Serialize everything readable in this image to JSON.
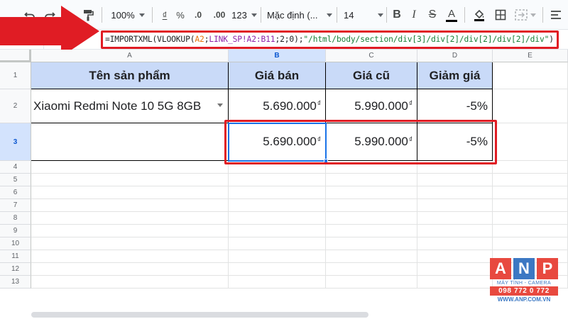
{
  "toolbar": {
    "zoom": "100%",
    "currency_symbol": "₫",
    "percent_symbol": "%",
    "decrease_decimal": ".0",
    "increase_decimal": ".00",
    "more_formats": "123",
    "font_family": "Mặc định (...",
    "font_size": "14",
    "bold": "B",
    "italic": "I",
    "strikethrough": "S",
    "text_color": "A"
  },
  "formula_bar": {
    "name_box": "B3",
    "formula_prefix": "=IMPORTXML(VLOOKUP(",
    "formula_ref1": "A2",
    "formula_sep1": ";",
    "formula_ref2": "LINK_SP!A2:B11",
    "formula_mid": ";2;0);",
    "formula_string": "\"/html/body/section/div[3]/div[2]/div[2]/div[2]/div\"",
    "formula_end": ")"
  },
  "columns": [
    "A",
    "B",
    "C",
    "D",
    "E"
  ],
  "rows": [
    "1",
    "2",
    "3",
    "4",
    "5",
    "6",
    "7",
    "8",
    "9",
    "10",
    "11",
    "12",
    "13"
  ],
  "table": {
    "headers": [
      "Tên sản phẩm",
      "Giá bán",
      "Giá cũ",
      "Giảm giá"
    ],
    "row2": {
      "product": "Xiaomi Redmi Note 10 5G 8GB",
      "price": "5.690.000",
      "old_price": "5.990.000",
      "discount": "-5%"
    },
    "row3": {
      "price": "5.690.000",
      "old_price": "5.990.000",
      "discount": "-5%"
    },
    "currency": "₫"
  },
  "logo": {
    "letters": [
      "A",
      "N",
      "P"
    ],
    "tagline": "MÁY TÍNH - CAMERA",
    "phone": "098 772 0 772",
    "website": "WWW.ANP.COM.VN"
  },
  "colors": {
    "header_fill": "#c9daf8",
    "annotation_red": "#e01c24",
    "selection_blue": "#1a73e8",
    "logo_a": "#e8493f",
    "logo_n": "#3c78c3",
    "logo_p": "#e8493f"
  }
}
